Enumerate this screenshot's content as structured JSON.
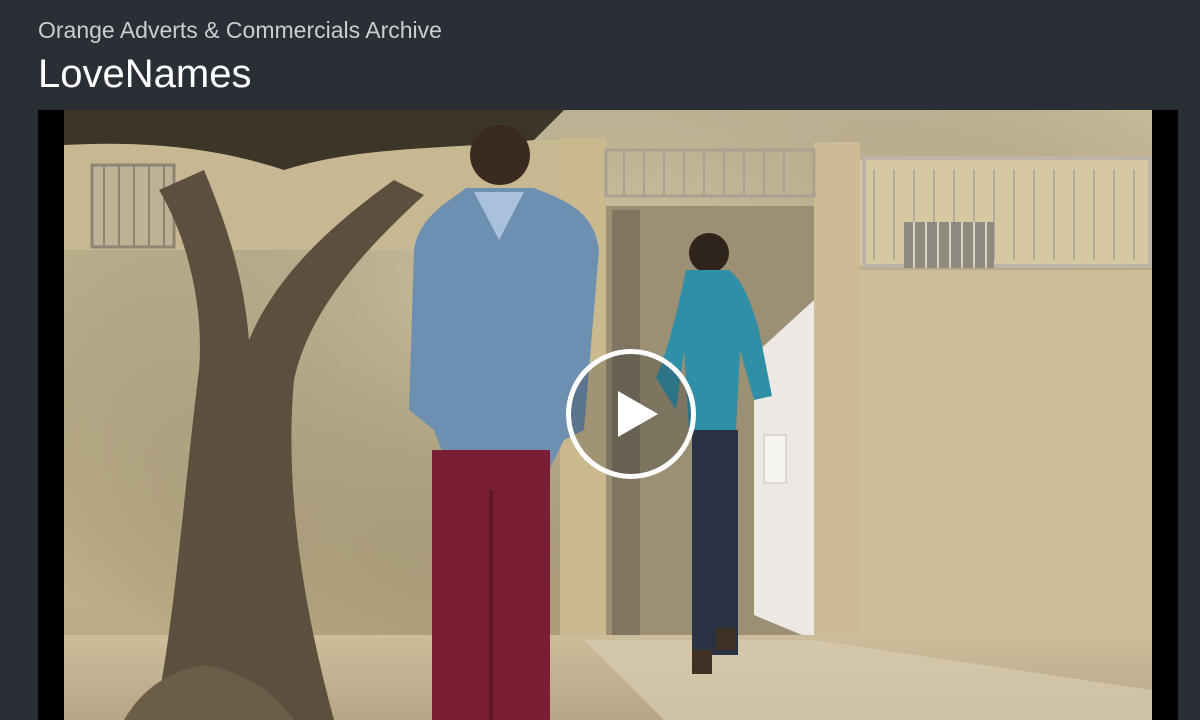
{
  "header": {
    "archive_name": "Orange Adverts & Commercials Archive",
    "video_title": "LoveNames"
  },
  "player": {
    "play_icon": "play-icon",
    "letterbox_color": "#000000"
  },
  "colors": {
    "background": "#2a2f35",
    "title": "#ffffff",
    "subtitle": "#c9ced3"
  }
}
